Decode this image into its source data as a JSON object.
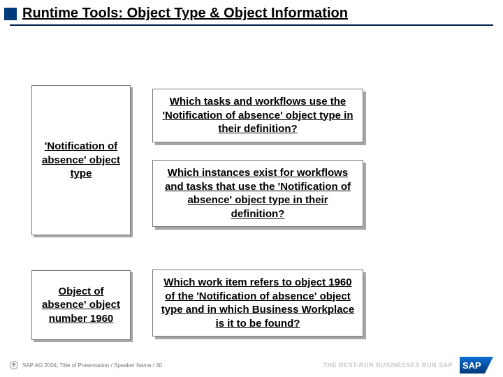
{
  "title": "Runtime Tools: Object Type & Object Information",
  "boxes": {
    "left1": "'Notification of absence' object type",
    "right1": "Which tasks and workflows use the 'Notification of absence' object type in their definition?",
    "right2": "Which instances exist for workflows and tasks that use the 'Notification of absence' object type in their definition?",
    "left2": "Object of absence' object number 1960",
    "right3": "Which work item refers to object 1960 of the 'Notification of absence' object type and in which Business Workplace is it to be found?"
  },
  "footer": {
    "copyright": "SAP AG 2004, Title of Presentation / Speaker Name / 40",
    "tagline": "THE BEST-RUN BUSINESSES RUN SAP",
    "logo_text": "SAP"
  }
}
